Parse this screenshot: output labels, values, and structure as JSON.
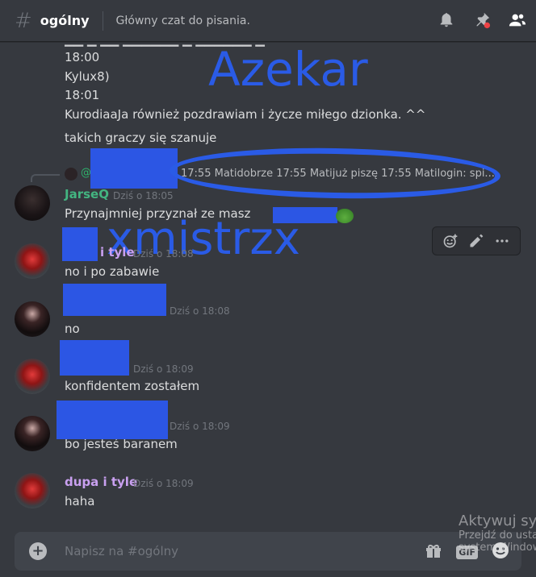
{
  "header": {
    "hash": "#",
    "channel": "ogólny",
    "topic": "Główny czat do pisania."
  },
  "messages_preview": {
    "line1": "18:00",
    "line2": "Kylux8)",
    "line3": "18:01",
    "line4": "KurodiaaJa również pozdrawiam i życze miłego dzionka. ^^",
    "line5": "takich graczy się szanuje"
  },
  "reply": {
    "at": "@",
    "text": "17:55 Matidobrze 17:55 Matijuż piszę 17:55 Matilogin: spi..."
  },
  "messages": [
    {
      "username": "JarseQ",
      "time": "Dziś o 18:05",
      "text": "Przynajmniej przyznał ze masz",
      "name_color": "#43b581"
    },
    {
      "username": "i tyle",
      "time": "Dziś o 18:08",
      "text": "no i po zabawie",
      "name_color": "#c9a0f0"
    },
    {
      "username": "",
      "time": "Dziś o 18:08",
      "text": "no",
      "name_color": "#ffffff"
    },
    {
      "username": "",
      "time": "Dziś o 18:09",
      "text": "konfidentem zostałem",
      "name_color": "#ffffff"
    },
    {
      "username": "",
      "time": "Dziś o 18:09",
      "text": "bo jesteś baranem",
      "name_color": "#ffffff"
    },
    {
      "username": "dupa i tyle",
      "time": "Dziś o 18:09",
      "text": "haha",
      "name_color": "#c9a0f0"
    }
  ],
  "annotations": {
    "top": "Azekar",
    "middle": "xmistrzx"
  },
  "composer": {
    "placeholder": "Napisz na #ogólny",
    "gif_label": "GIF"
  },
  "watermark": {
    "title": "Aktywuj sys",
    "line1": "Przejdź do usta",
    "line2": "system Window"
  },
  "icons": {
    "header": [
      "bell-icon",
      "pin-icon",
      "members-icon"
    ],
    "toolbar": [
      "add-reaction-icon",
      "edit-icon",
      "more-icon"
    ],
    "composer": [
      "plus-icon",
      "gift-icon",
      "gif-icon",
      "emoji-icon"
    ]
  },
  "colors": {
    "background": "#36393f",
    "annotation_blue": "#2a5be6",
    "green_name": "#43b581",
    "purple_name": "#c9a0f0"
  }
}
